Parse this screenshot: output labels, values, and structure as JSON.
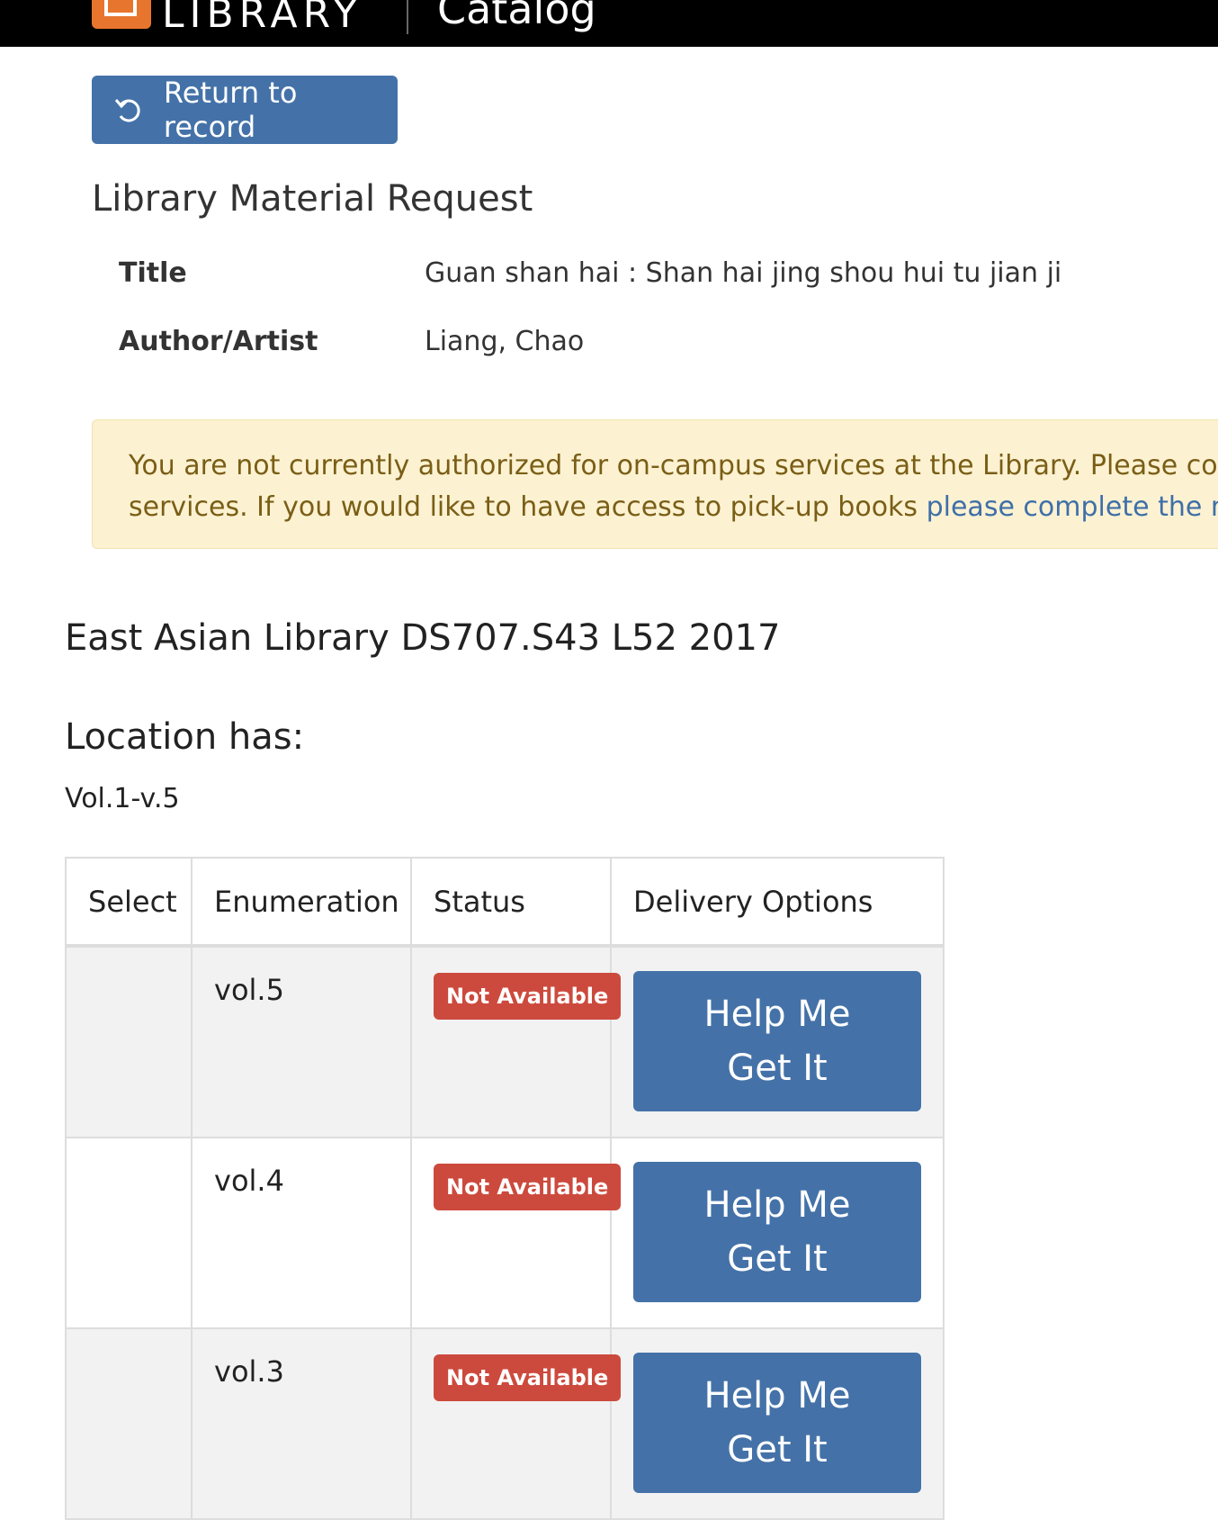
{
  "header": {
    "logo_text": "LIBRARY",
    "section_title": "Catalog"
  },
  "return_button": {
    "label": "Return to record",
    "icon": "undo-icon"
  },
  "page_title": "Library Material Request",
  "record": {
    "title_label": "Title",
    "title_value": "Guan shan hai : Shan hai jing shou hui tu jian ji",
    "author_label": "Author/Artist",
    "author_value": "Liang, Chao"
  },
  "alert": {
    "line1": "You are not currently authorized for on-campus services at the Library. Please consu",
    "line2": "services. If you would like to have access to pick-up books ",
    "link_text": "please complete the mar"
  },
  "location": {
    "heading": "East Asian Library DS707.S43 L52 2017",
    "has_heading": "Location has:",
    "has_value": "Vol.1-v.5"
  },
  "table": {
    "headers": [
      "Select",
      "Enumeration",
      "Status",
      "Delivery Options"
    ],
    "rows": [
      {
        "select": "",
        "enumeration": "vol.5",
        "status": "Not Available",
        "delivery": "Help Me Get It"
      },
      {
        "select": "",
        "enumeration": "vol.4",
        "status": "Not Available",
        "delivery": "Help Me Get It"
      },
      {
        "select": "",
        "enumeration": "vol.3",
        "status": "Not Available",
        "delivery": "Help Me Get It"
      }
    ]
  },
  "colors": {
    "primary": "#4472a8",
    "danger": "#cc4a3d",
    "warning_bg": "#fcf2d2",
    "brand_orange": "#e8752e"
  }
}
